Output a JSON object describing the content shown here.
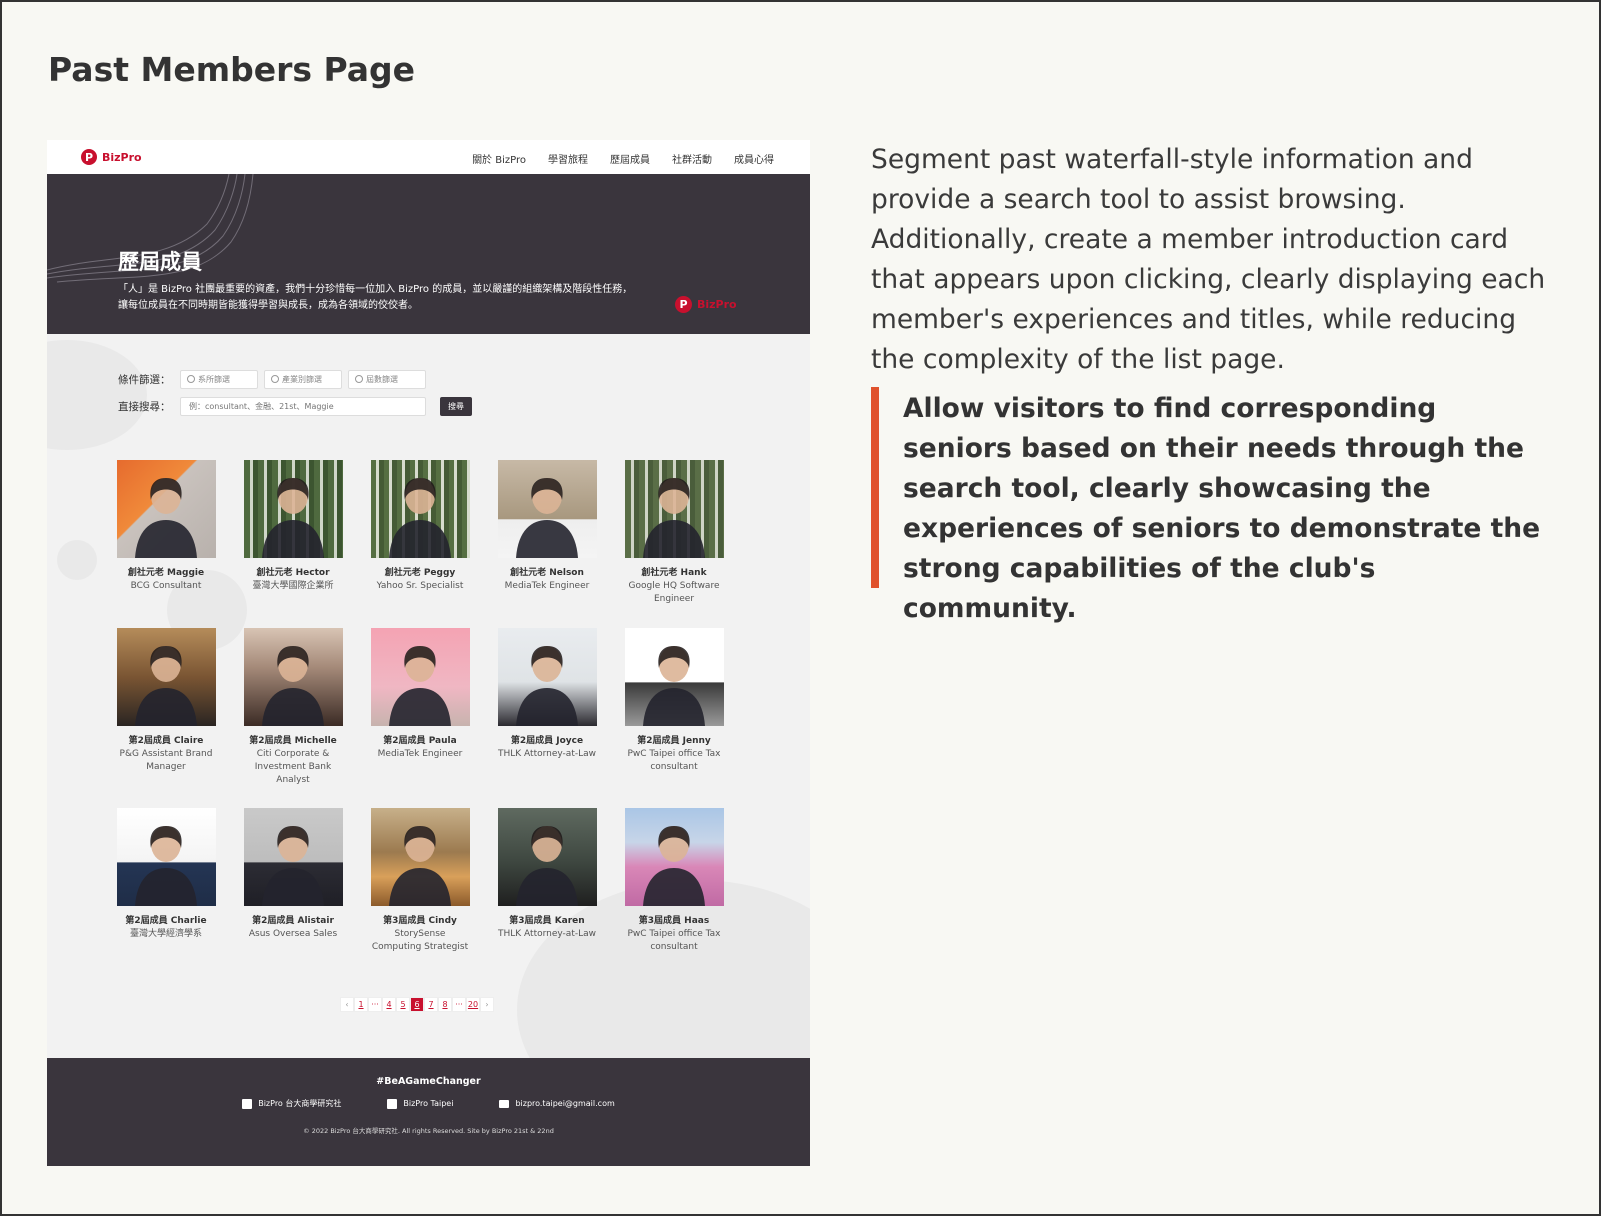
{
  "page_heading": "Past Members Page",
  "site": {
    "logo": "BizPro",
    "nav": [
      "關於 BizPro",
      "學習旅程",
      "歷屆成員",
      "社群活動",
      "成員心得"
    ],
    "hero": {
      "title": "歷屆成員",
      "description": "「人」是 BizPro 社團最重要的資產，我們十分珍惜每一位加入 BizPro 的成員，並以嚴謹的組織架構及階段性任務，讓每位成員在不同時期皆能獲得學習與成長，成為各領域的佼佼者。",
      "logo": "BizPro"
    },
    "filters": {
      "filter_label": "條件篩選：",
      "selects": [
        "系所篩選",
        "產業別篩選",
        "屆數篩選"
      ],
      "search_label": "直接搜尋：",
      "search_placeholder": "例：consultant、金融、21st、Maggie",
      "search_button": "搜尋"
    },
    "members": [
      {
        "name": "創社元老 Maggie",
        "role": "BCG Consultant"
      },
      {
        "name": "創社元老 Hector",
        "role": "臺灣大學國際企業所"
      },
      {
        "name": "創社元老 Peggy",
        "role": "Yahoo Sr. Specialist"
      },
      {
        "name": "創社元老 Nelson",
        "role": "MediaTek Engineer"
      },
      {
        "name": "創社元老 Hank",
        "role": "Google HQ Software Engineer"
      },
      {
        "name": "第2屆成員 Claire",
        "role": "P&G Assistant Brand Manager"
      },
      {
        "name": "第2屆成員 Michelle",
        "role": "Citi Corporate & Investment Bank Analyst"
      },
      {
        "name": "第2屆成員 Paula",
        "role": "MediaTek Engineer"
      },
      {
        "name": "第2屆成員 Joyce",
        "role": "THLK Attorney-at-Law"
      },
      {
        "name": "第2屆成員 Jenny",
        "role": "PwC Taipei office Tax consultant"
      },
      {
        "name": "第2屆成員 Charlie",
        "role": "臺灣大學經濟學系"
      },
      {
        "name": "第2屆成員 Alistair",
        "role": "Asus Oversea Sales"
      },
      {
        "name": "第3屆成員 Cindy",
        "role": "StorySense Computing Strategist"
      },
      {
        "name": "第3屆成員 Karen",
        "role": "THLK Attorney-at-Law"
      },
      {
        "name": "第3屆成員 Haas",
        "role": "PwC Taipei office Tax consultant"
      }
    ],
    "pagination": {
      "prev": "‹",
      "pages": [
        "1",
        "···",
        "4",
        "5",
        "6",
        "7",
        "8",
        "···",
        "20"
      ],
      "active": "6",
      "next": "›"
    },
    "footer": {
      "hashtag": "#BeAGameChanger",
      "social": [
        {
          "icon": "facebook-icon",
          "label": "BizPro 台大商學研究社"
        },
        {
          "icon": "linkedin-icon",
          "label": "BizPro Taipei"
        },
        {
          "icon": "mail-icon",
          "label": "bizpro.taipei@gmail.com"
        }
      ],
      "copyright": "© 2022 BizPro 台大商學研究社. All rights Reserved. Site by BizPro 21st & 22nd"
    }
  },
  "intro_text": "Segment past waterfall-style information and provide a search tool to assist browsing. Additionally, create a member introduction card that appears upon clicking, clearly displaying each member's experiences and titles, while reducing the complexity of the list page.",
  "quote_text": "Allow visitors to find corresponding seniors based on their needs through the search tool, clearly showcasing the experiences of seniors to demonstrate the strong capabilities of the club's community.",
  "colors": {
    "accent": "#c8102e",
    "quote_bar": "#e0522c",
    "dark_band": "#3a353d",
    "background": "#f8f8f3"
  }
}
